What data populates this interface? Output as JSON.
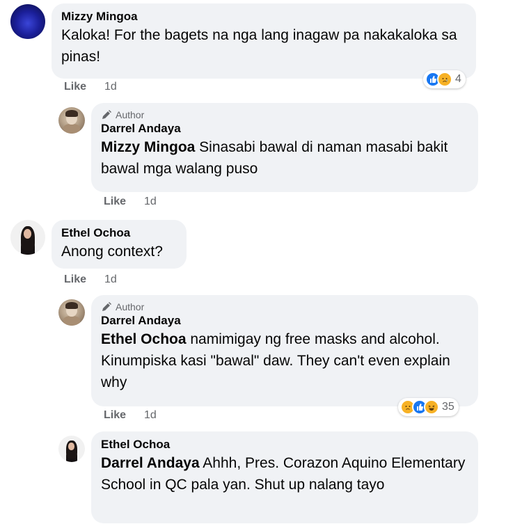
{
  "comments": [
    {
      "author": "Mizzy Mingoa",
      "text": "Kaloka! For the bagets na nga lang inagaw pa nakakaloka sa pinas!",
      "like_label": "Like",
      "time": "1d",
      "reaction_count": "4",
      "reaction_icons": [
        "like-icon",
        "sad-icon"
      ]
    },
    {
      "badge": "Author",
      "author": "Darrel Andaya",
      "mention": "Mizzy Mingoa",
      "text": " Sinasabi bawal di naman masabi bakit bawal mga walang puso",
      "like_label": "Like",
      "time": "1d"
    },
    {
      "author": "Ethel Ochoa",
      "text": "Anong context?",
      "like_label": "Like",
      "time": "1d"
    },
    {
      "badge": "Author",
      "author": "Darrel Andaya",
      "mention": "Ethel Ochoa",
      "text": " namimigay ng free masks and alcohol. Kinumpiska kasi \"bawal\" daw. They can't even explain why",
      "like_label": "Like",
      "time": "1d",
      "reaction_count": "35",
      "reaction_icons": [
        "sad-icon",
        "like-icon",
        "haha-icon"
      ]
    },
    {
      "author": "Ethel Ochoa",
      "mention": "Darrel Andaya",
      "text": " Ahhh, Pres. Corazon Aquino Elementary School in QC pala yan. Shut up nalang tayo"
    }
  ]
}
